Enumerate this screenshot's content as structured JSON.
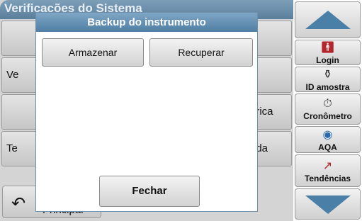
{
  "background": {
    "title": "Verificações do Sistema",
    "rows": [
      {
        "left": "",
        "right": ""
      },
      {
        "left": "Ve",
        "right": ""
      },
      {
        "left": "",
        "right": "brica"
      },
      {
        "left": "Te",
        "right": "ada"
      }
    ],
    "back_label": "Principal"
  },
  "dialog": {
    "title": "Backup do instrumento",
    "store_label": "Armazenar",
    "restore_label": "Recuperar",
    "close_label": "Fechar"
  },
  "sidebar": {
    "items": [
      {
        "label": "Login",
        "icon": "person-icon"
      },
      {
        "label": "ID amostra",
        "icon": "sample-vial-icon"
      },
      {
        "label": "Cronômetro",
        "icon": "timer-icon"
      },
      {
        "label": "AQA",
        "icon": "aqa-icon"
      },
      {
        "label": "Tendências",
        "icon": "trend-chart-icon"
      }
    ]
  },
  "colors": {
    "accent": "#4a7fa8",
    "title_bar": "#5a7f9c"
  }
}
